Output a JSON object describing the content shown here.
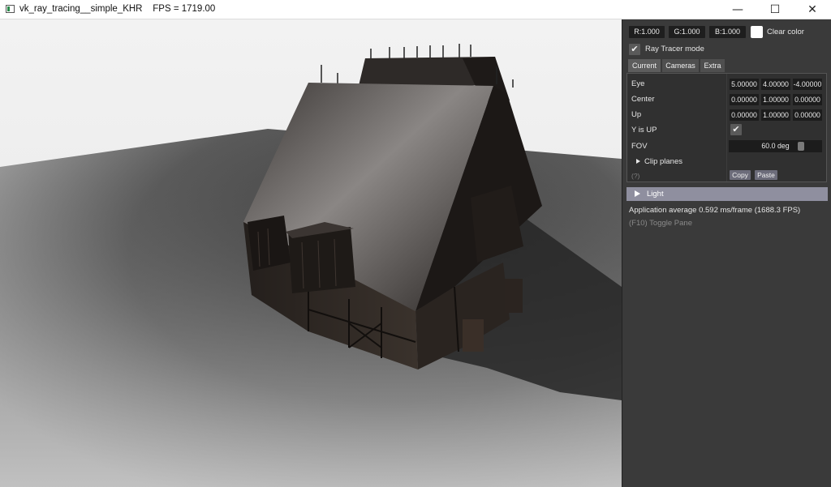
{
  "window": {
    "title": "vk_ray_tracing__simple_KHR    FPS = 1719.00",
    "minimize_glyph": "—",
    "maximize_glyph": "☐",
    "close_glyph": "✕"
  },
  "panel": {
    "clear_color": {
      "r": "R:1.000",
      "g": "G:1.000",
      "b": "B:1.000",
      "label": "Clear color",
      "swatch_color": "#ffffff"
    },
    "ray_tracer": {
      "label": "Ray Tracer mode",
      "checked": true,
      "check_glyph": "✔"
    },
    "tabs": [
      {
        "label": "Current"
      },
      {
        "label": "Cameras"
      },
      {
        "label": "Extra"
      }
    ],
    "camera": {
      "eye": {
        "label": "Eye",
        "values": [
          "5.00000",
          "4.00000",
          "-4.00000"
        ]
      },
      "center": {
        "label": "Center",
        "values": [
          "0.00000",
          "1.00000",
          "0.00000"
        ]
      },
      "up": {
        "label": "Up",
        "values": [
          "0.00000",
          "1.00000",
          "0.00000"
        ]
      },
      "y_is_up": {
        "label": "Y is UP",
        "checked": true
      },
      "fov": {
        "label": "FOV",
        "value": "60.0 deg"
      },
      "clip_planes": {
        "label": "Clip planes"
      },
      "help": "(?)",
      "copy": "Copy",
      "paste": "Paste"
    },
    "light": {
      "label": "Light"
    },
    "stats": "Application average 0.592 ms/frame (1688.3 FPS)",
    "toggle_hint": "(F10) Toggle Pane"
  }
}
